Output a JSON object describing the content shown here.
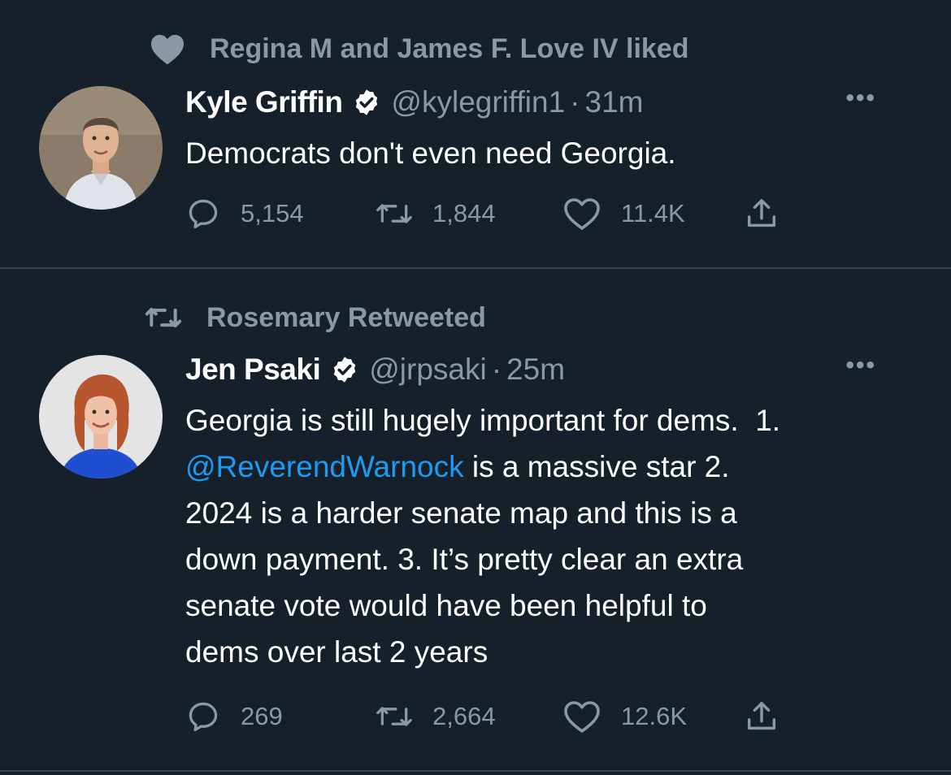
{
  "tweets": [
    {
      "context": {
        "type": "like",
        "text": "Regina M and James F. Love IV liked",
        "icon": "heart-filled-icon"
      },
      "author": {
        "name": "Kyle Griffin",
        "handle": "@kylegriffin1",
        "verified": true
      },
      "time": "31m",
      "more": "•••",
      "text": "Democrats don't even need Georgia.",
      "actions": {
        "replies": "5,154",
        "retweets": "1,844",
        "likes": "11.4K"
      }
    },
    {
      "context": {
        "type": "retweet",
        "text": "Rosemary Retweeted",
        "icon": "retweet-icon"
      },
      "author": {
        "name": "Jen Psaki",
        "handle": "@jrpsaki",
        "verified": true
      },
      "time": "25m",
      "more": "•••",
      "text_before_mention": "Georgia is still hugely important for dems.  1.\n",
      "mention": "@ReverendWarnock",
      "text_after_mention": " is a massive star 2.\n2024 is a harder senate map and this is a\ndown payment. 3. It’s pretty clear an extra\nsenate vote would have been helpful to\ndems over last 2 years",
      "actions": {
        "replies": "269",
        "retweets": "2,664",
        "likes": "12.6K"
      }
    }
  ],
  "colors": {
    "background": "#15202b",
    "secondary_text": "#8b98a5",
    "link": "#1d9bf0",
    "divider": "#38444d"
  }
}
